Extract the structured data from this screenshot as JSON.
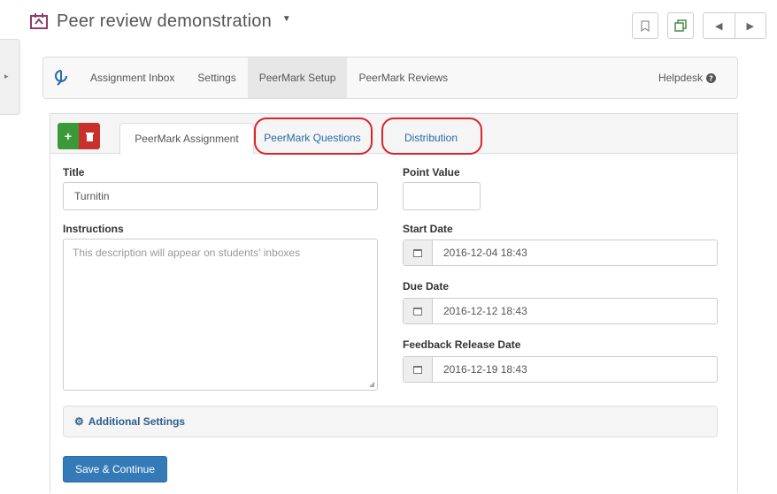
{
  "page": {
    "title": "Peer review demonstration"
  },
  "nav": {
    "items": [
      "Assignment Inbox",
      "Settings",
      "PeerMark Setup",
      "PeerMark Reviews"
    ],
    "active": "PeerMark Setup",
    "help": "Helpdesk"
  },
  "tabs": {
    "assignment": "PeerMark Assignment",
    "questions": "PeerMark Questions",
    "distribution": "Distribution"
  },
  "form": {
    "title_label": "Title",
    "title_value": "Turnitin",
    "instructions_label": "Instructions",
    "instructions_placeholder": "This description will appear on students' inboxes",
    "point_value_label": "Point Value",
    "point_value": "",
    "start_label": "Start Date",
    "start_value": "2016-12-04 18:43",
    "due_label": "Due Date",
    "due_value": "2016-12-12 18:43",
    "release_label": "Feedback Release Date",
    "release_value": "2016-12-19 18:43",
    "additional_label": "Additional Settings",
    "save_label": "Save & Continue"
  },
  "colors": {
    "primary": "#337ab7",
    "add": "#3a9a3a",
    "delete": "#c9302c",
    "highlight_ring": "#d9232d",
    "title_icon": "#8e3b6b"
  }
}
